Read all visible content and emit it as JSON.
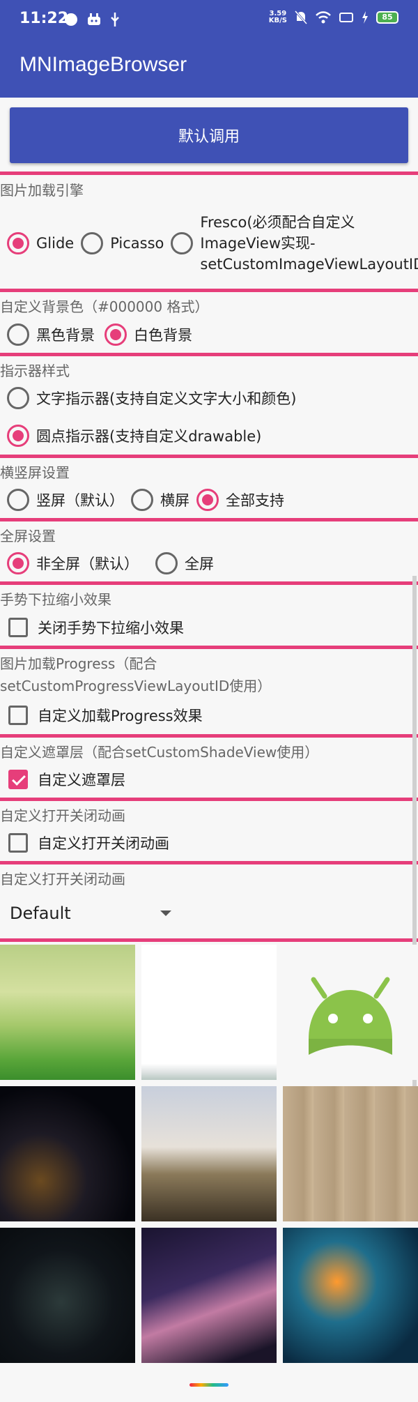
{
  "status_bar": {
    "time": "11:22",
    "speed_value": "3.59",
    "speed_unit": "KB/S",
    "battery": "85"
  },
  "app_bar": {
    "title": "MNImageBrowser"
  },
  "default_button": "默认调用",
  "sections": {
    "engine": {
      "title": "图片加载引擎",
      "options": [
        "Glide",
        "Picasso",
        "Fresco(必须配合自定义ImageView实现-setCustomImageViewLayoutID)"
      ],
      "selected": "Glide"
    },
    "background": {
      "title": "自定义背景色（#000000 格式）",
      "options": [
        "黑色背景",
        "白色背景"
      ],
      "selected": "白色背景"
    },
    "indicator": {
      "title": "指示器样式",
      "options": [
        "文字指示器(支持自定义文字大小和颜色)",
        "圆点指示器(支持自定义drawable)"
      ],
      "selected": "圆点指示器(支持自定义drawable)"
    },
    "orientation": {
      "title": "横竖屏设置",
      "options": [
        "竖屏（默认）",
        "横屏",
        "全部支持"
      ],
      "selected": "全部支持"
    },
    "fullscreen": {
      "title": "全屏设置",
      "options": [
        "非全屏（默认）",
        "全屏"
      ],
      "selected": "非全屏（默认）"
    },
    "gesture": {
      "title": "手势下拉缩小效果",
      "checkbox_label": "关闭手势下拉缩小效果",
      "checked": false
    },
    "progress": {
      "title_line1": "图片加载Progress（配合",
      "title_line2": "setCustomProgressViewLayoutID使用）",
      "checkbox_label": "自定义加载Progress效果",
      "checked": false
    },
    "shade": {
      "title": "自定义遮罩层（配合setCustomShadeView使用）",
      "checkbox_label": "自定义遮罩层",
      "checked": true
    },
    "anim_toggle": {
      "title": "自定义打开关闭动画",
      "checkbox_label": "自定义打开关闭动画",
      "checked": false
    },
    "anim_select": {
      "title": "自定义打开关闭动画",
      "selected_value": "Default"
    }
  },
  "colors": {
    "primary": "#3f51b5",
    "accent": "#e63e7a",
    "background": "#f7f7f7"
  },
  "icons": {
    "status_left": [
      "moon-icon",
      "android-icon",
      "usb-icon"
    ],
    "status_right": [
      "mute-icon",
      "wifi-icon",
      "screen-icon",
      "charging-icon"
    ]
  }
}
